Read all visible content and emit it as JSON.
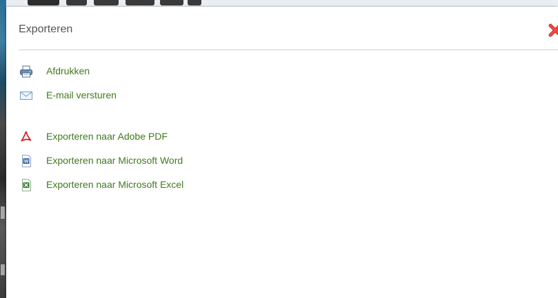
{
  "dialog": {
    "title": "Exporteren",
    "close_icon": "close-icon"
  },
  "menu": {
    "print": {
      "label": "Afdrukken",
      "icon": "printer-icon"
    },
    "email": {
      "label": "E-mail versturen",
      "icon": "envelope-icon"
    },
    "pdf": {
      "label": "Exporteren naar Adobe PDF",
      "icon": "pdf-icon"
    },
    "word": {
      "label": "Exporteren naar Microsoft Word",
      "icon": "word-icon"
    },
    "excel": {
      "label": "Exporteren naar Microsoft Excel",
      "icon": "excel-icon"
    }
  },
  "colors": {
    "link": "#3f7a1c",
    "close": "#e0322b",
    "title": "#555555",
    "divider": "#cfcfcf"
  }
}
